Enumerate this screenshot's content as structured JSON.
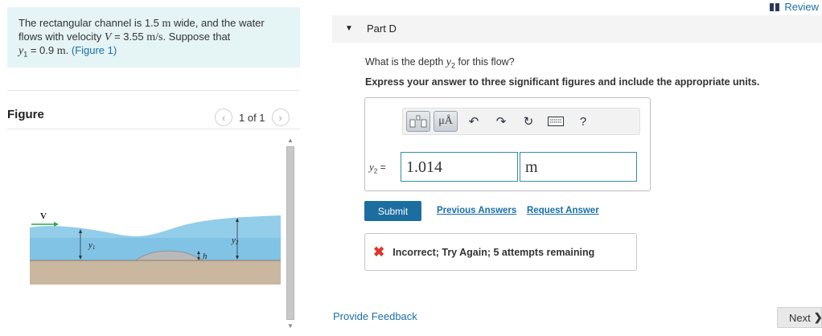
{
  "problem": {
    "line1_text": "The rectangular channel is 1.5 ",
    "line1_unit": "m",
    "line1_tail": " wide, and the water",
    "line2_text": "flows with velocity ",
    "line2_var": "V",
    "line2_value": " = 3.55 ",
    "line2_unit": "m/s",
    "line2_tail": ". Suppose that",
    "line3_var": "y",
    "line3_sub": "1",
    "line3_value": " = 0.9 ",
    "line3_unit": "m",
    "line3_tail": ". ",
    "figure_link": "(Figure 1)"
  },
  "figure": {
    "title": "Figure",
    "pager_text": "1 of 1",
    "prev_icon": "chevron-left-icon",
    "next_icon": "chevron-right-icon",
    "labels": {
      "velocity": "V",
      "y1": "y",
      "y1_sub": "1",
      "y2": "y",
      "y2_sub": "2",
      "h": "h"
    },
    "colors": {
      "water": "#7fc4e6",
      "ground": "#c9b79f",
      "hump": "#b9b9b9",
      "arrow": "#2aa847"
    }
  },
  "header": {
    "review_label": "Review"
  },
  "part": {
    "title": "Part D"
  },
  "question": {
    "text_pre": "What is the depth ",
    "var": "y",
    "sub": "2",
    "text_post": " for this flow?",
    "instruction": "Express your answer to three significant figures and include the appropriate units."
  },
  "toolbar": {
    "templates_icon": "templates-icon",
    "units_label": "μÅ",
    "undo_icon": "undo-icon",
    "redo_icon": "redo-icon",
    "reset_icon": "reset-icon",
    "keyboard_icon": "keyboard-icon",
    "help_label": "?"
  },
  "answer": {
    "label_var": "y",
    "label_sub": "2",
    "label_eq": " = ",
    "value": "1.014",
    "unit": "m"
  },
  "actions": {
    "submit_label": "Submit",
    "previous_answers_label": "Previous Answers",
    "request_answer_label": "Request Answer"
  },
  "feedback": {
    "message": "Incorrect; Try Again; 5 attempts remaining",
    "status_color": "#d9372a"
  },
  "footer": {
    "provide_feedback_label": "Provide Feedback",
    "next_label": "Next"
  }
}
